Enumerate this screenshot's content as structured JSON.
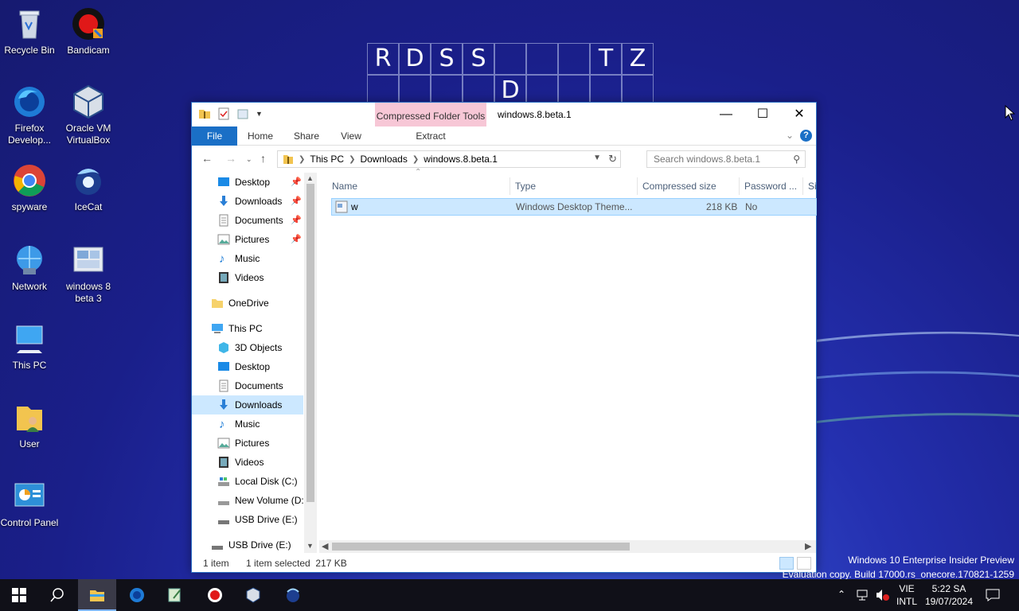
{
  "desktop": {
    "icons": [
      {
        "label": "Recycle Bin"
      },
      {
        "label": "Bandicam"
      },
      {
        "label": "Firefox Develop..."
      },
      {
        "label": "Oracle VM VirtualBox"
      },
      {
        "label": "spyware"
      },
      {
        "label": "IceCat"
      },
      {
        "label": "Network"
      },
      {
        "label": "windows 8 beta 3"
      },
      {
        "label": "This PC"
      },
      {
        "label": "User"
      },
      {
        "label": "Control Panel"
      }
    ],
    "grid": {
      "row1": [
        "R",
        "D",
        "S",
        "S",
        "",
        "",
        "",
        "T",
        "Z"
      ],
      "row2": [
        "",
        "",
        "",
        "",
        "D",
        "",
        "",
        "",
        ""
      ]
    },
    "watermark": {
      "line1": "Windows 10 Enterprise Insider Preview",
      "line2": "Evaluation copy. Build 17000.rs_onecore.170821-1259"
    }
  },
  "window": {
    "title": "windows.8.beta.1",
    "context_tab": "Compressed Folder Tools",
    "ribbon_tabs": {
      "file": "File",
      "home": "Home",
      "share": "Share",
      "view": "View",
      "extract": "Extract"
    },
    "address": {
      "p1": "This PC",
      "p2": "Downloads",
      "p3": "windows.8.beta.1"
    },
    "search_placeholder": "Search windows.8.beta.1",
    "nav": {
      "quick": [
        "Desktop",
        "Downloads",
        "Documents",
        "Pictures",
        "Music",
        "Videos"
      ],
      "onedrive": "OneDrive",
      "thispc": "This PC",
      "pc_items": [
        "3D Objects",
        "Desktop",
        "Documents",
        "Downloads",
        "Music",
        "Pictures",
        "Videos",
        "Local Disk (C:)",
        "New Volume (D:",
        "USB Drive (E:)"
      ],
      "usb": "USB Drive (E:)"
    },
    "columns": {
      "name": "Name",
      "type": "Type",
      "compressed": "Compressed size",
      "password": "Password ...",
      "size": "Si"
    },
    "file": {
      "name": "w",
      "type": "Windows Desktop Theme...",
      "compressed": "218 KB",
      "password": "No"
    },
    "status": {
      "count": "1 item",
      "selected": "1 item selected  217 KB"
    }
  },
  "taskbar": {
    "lang_top": "VIE",
    "lang_bottom": "INTL",
    "time": "5:22 SA",
    "date": "19/07/2024"
  }
}
